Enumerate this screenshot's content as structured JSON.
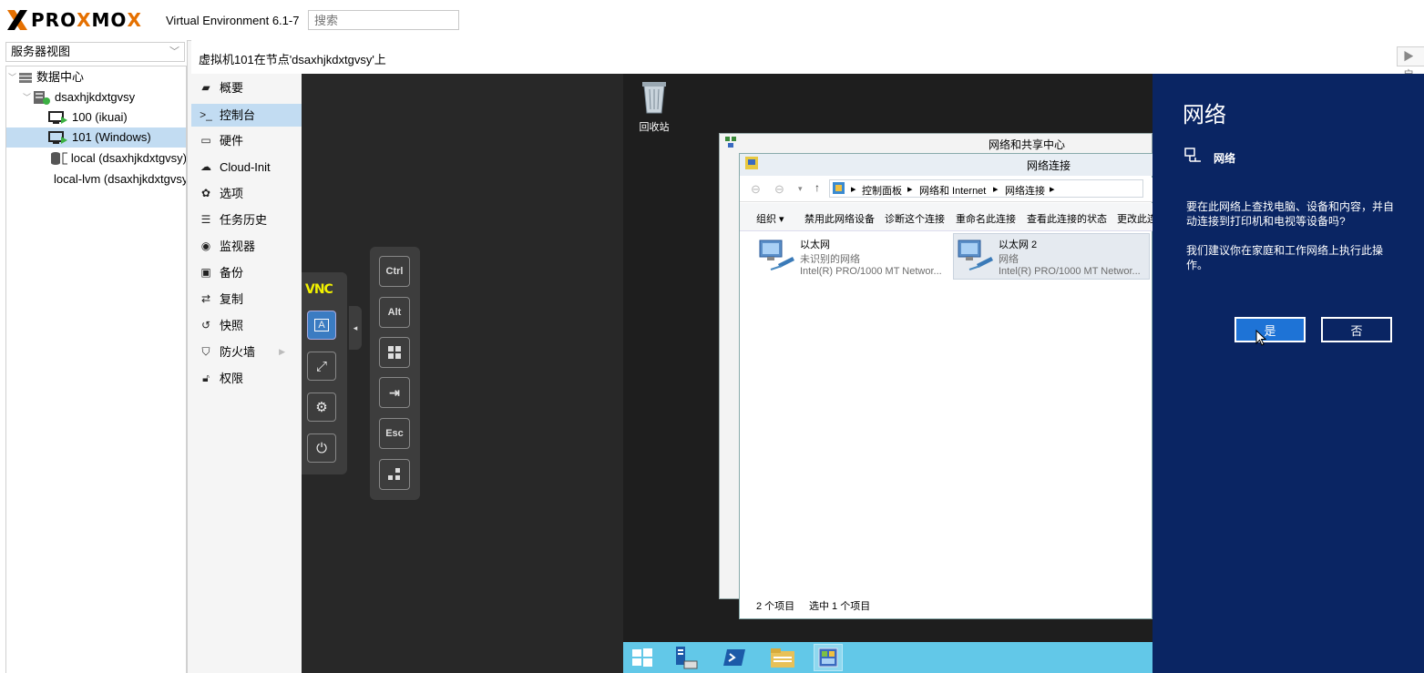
{
  "app": {
    "brand": "PROXMOX",
    "version": "Virtual Environment 6.1-7",
    "search_placeholder": "搜索"
  },
  "view_selector": {
    "value": "服务器视图"
  },
  "tree": [
    {
      "label": "数据中心",
      "type": "datacenter"
    },
    {
      "label": "dsaxhjkdxtgvsy",
      "type": "node"
    },
    {
      "label": "100 (ikuai)",
      "type": "vm"
    },
    {
      "label": "101 (Windows)",
      "type": "vm",
      "selected": true
    },
    {
      "label": "local (dsaxhjkdxtgvsy)",
      "type": "storage"
    },
    {
      "label": "local-lvm (dsaxhjkdxtgvsy)",
      "type": "storage"
    }
  ],
  "header": {
    "title": "虚拟机101在节点'dsaxhjkdxtgvsy'上",
    "start_label": "▶ 启"
  },
  "menu": [
    {
      "label": "概要",
      "icon": "book-icon"
    },
    {
      "label": "控制台",
      "icon": "terminal-icon",
      "selected": true
    },
    {
      "label": "硬件",
      "icon": "monitor-icon"
    },
    {
      "label": "Cloud-Init",
      "icon": "cloud-icon"
    },
    {
      "label": "选项",
      "icon": "gear-icon"
    },
    {
      "label": "任务历史",
      "icon": "list-icon"
    },
    {
      "label": "监视器",
      "icon": "eye-icon"
    },
    {
      "label": "备份",
      "icon": "floppy-icon"
    },
    {
      "label": "复制",
      "icon": "retweet-icon"
    },
    {
      "label": "快照",
      "icon": "history-icon"
    },
    {
      "label": "防火墙",
      "icon": "shield-icon"
    },
    {
      "label": "权限",
      "icon": "unlock-icon"
    }
  ],
  "vnc": {
    "logo": "VNC",
    "keys": [
      "Ctrl",
      "Alt",
      "windows-icon",
      "tab-icon",
      "Esc",
      "dots-icon"
    ]
  },
  "desktop": {
    "recycle_label": "回收站",
    "window1_title": "网络和共享中心",
    "window2_title": "网络连接",
    "breadcrumb": [
      "控制面板",
      "网络和 Internet",
      "网络连接"
    ],
    "commands": [
      "组织 ▾",
      "禁用此网络设备",
      "诊断这个连接",
      "重命名此连接",
      "查看此连接的状态",
      "更改此连"
    ],
    "connections": [
      {
        "name": "以太网",
        "status": "未识别的网络",
        "adapter": "Intel(R) PRO/1000 MT Networ..."
      },
      {
        "name": "以太网 2",
        "status": "网络",
        "adapter": "Intel(R) PRO/1000 MT Networ...",
        "selected": true
      }
    ],
    "status_items": "2 个项目",
    "status_selected": "选中 1 个项目"
  },
  "charm": {
    "title": "网络",
    "network_name": "网络",
    "question": "要在此网络上查找电脑、设备和内容，并自动连接到打印机和电视等设备吗?",
    "advice": "我们建议你在家庭和工作网络上执行此操作。",
    "yes_label": "是",
    "no_label": "否"
  },
  "colors": {
    "accent_orange": "#e57000",
    "selection_blue": "#c2dcf2",
    "charm_bg": "#0a2563",
    "taskbar": "#62c8e8"
  }
}
